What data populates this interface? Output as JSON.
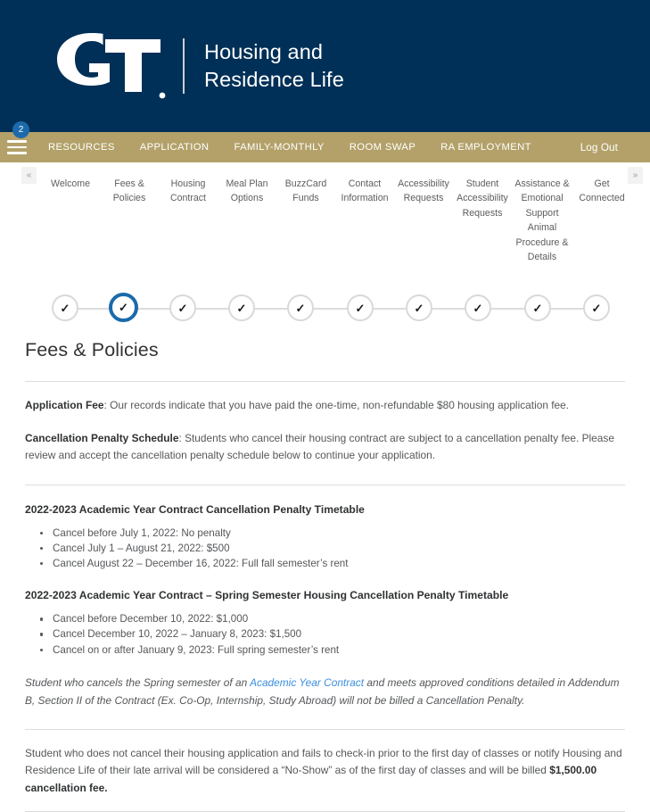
{
  "header": {
    "logo_alt": "Georgia Tech GT monogram",
    "site_title": "Housing and\nResidence Life",
    "background_color": "#003057"
  },
  "navbar": {
    "background_color": "#b3a169",
    "badge_count": "2",
    "menu_icon": "hamburger-icon",
    "links": [
      {
        "label": "RESOURCES"
      },
      {
        "label": "APPLICATION"
      },
      {
        "label": "FAMILY-MONTHLY"
      },
      {
        "label": "ROOM SWAP"
      },
      {
        "label": "RA EMPLOYMENT"
      }
    ],
    "logout_label": "Log Out"
  },
  "tabstrip": {
    "prev_arrow": "«",
    "next_arrow": "»",
    "tabs": [
      {
        "label": "Welcome",
        "active": false
      },
      {
        "label": "Fees & Policies",
        "active": true
      },
      {
        "label": "Housing Contract",
        "active": false
      },
      {
        "label": "Meal Plan Options",
        "active": false
      },
      {
        "label": "BuzzCard Funds",
        "active": false
      },
      {
        "label": "Contact Information",
        "active": false
      },
      {
        "label": "Accessibility Requests",
        "active": false
      },
      {
        "label": "Student Accessibility Requests",
        "active": false
      },
      {
        "label": "Assistance & Emotional Support Animal Procedure & Details",
        "active": false
      },
      {
        "label": "Get Connected",
        "active": false
      }
    ]
  },
  "steps": {
    "active_index": 1,
    "active_color": "#1b6aab",
    "inactive_color": "#d9d9d9",
    "items": [
      {
        "icon": "check-icon",
        "state": "complete"
      },
      {
        "icon": "check-icon",
        "state": "current"
      },
      {
        "icon": "check-icon",
        "state": "complete"
      },
      {
        "icon": "check-icon",
        "state": "complete"
      },
      {
        "icon": "check-icon",
        "state": "complete"
      },
      {
        "icon": "check-icon",
        "state": "complete"
      },
      {
        "icon": "check-icon",
        "state": "complete"
      },
      {
        "icon": "check-icon",
        "state": "complete"
      },
      {
        "icon": "check-icon",
        "state": "complete"
      },
      {
        "icon": "check-icon",
        "state": "complete"
      }
    ]
  },
  "main": {
    "page_title": "Fees & Policies",
    "application_fee_label": "Application Fee",
    "application_fee_text": ": Our records indicate that you have paid the one-time, non-refundable $80 housing application fee.",
    "cancellation_label": "Cancellation Penalty Schedule",
    "cancellation_text": ": Students who cancel their housing contract are subject to a cancellation penalty fee. Please review and accept the cancellation penalty schedule below to continue your application.",
    "section_one_heading": "2022-2023 Academic Year Contract Cancellation Penalty Timetable",
    "section_one_bullets": [
      "Cancel before July 1, 2022: No penalty",
      "Cancel July 1 – August 21, 2022: $500",
      "Cancel August 22 – December 16, 2022: Full fall semester’s rent"
    ],
    "section_two_heading": "2022-2023 Academic Year Contract – Spring Semester Housing Cancellation Penalty Timetable",
    "section_two_bullets": [
      "Cancel before December 10, 2022: $1,000",
      "Cancel December 10, 2022 – January 8, 2023: $1,500",
      "Cancel on or after January 9, 2023: Full spring semester’s rent"
    ],
    "note_part_one": "Student who cancels the Spring semester of an ",
    "note_link_text": "Academic Year Contract",
    "note_part_two": " and meets approved conditions detailed in Addendum B, Section II of the Contract (Ex. Co-Op, Internship, Study Abroad) will not be billed a Cancellation Penalty.",
    "noshow_part_one": "Student who does not cancel their housing application and fails to check-in prior to the first day of classes or notify Housing and Residence Life of their late arrival will be considered a “No-Show” as of the first day of classes and will be billed ",
    "noshow_bold": "$1,500.00 cancellation fee.",
    "link_color": "#3b8ede"
  }
}
